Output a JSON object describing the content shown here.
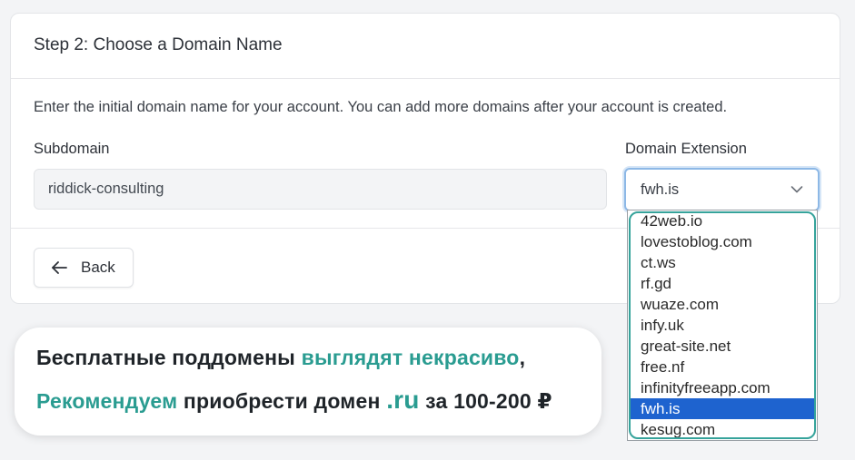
{
  "colors": {
    "accent_teal": "#2a9c91",
    "selected_option": "#1e63cf",
    "focus_ring": "#8db8e6",
    "page_background": "#f3f4f6"
  },
  "step": {
    "title": "Step 2: Choose a Domain Name",
    "description": "Enter the initial domain name for your account. You can add more domains after your account is created."
  },
  "subdomain": {
    "label": "Subdomain",
    "value": "riddick-consulting"
  },
  "domain_extension": {
    "label": "Domain Extension",
    "selected": "fwh.is",
    "icon": "chevron-down-icon",
    "options": [
      "42web.io",
      "lovestoblog.com",
      "ct.ws",
      "rf.gd",
      "wuaze.com",
      "infy.uk",
      "great-site.net",
      "free.nf",
      "infinityfreeapp.com",
      "fwh.is",
      "kesug.com"
    ],
    "selected_index": 9
  },
  "footer": {
    "back_label": "Back",
    "back_icon": "arrow-left-icon"
  },
  "promo": {
    "line1_a": "Бесплатные поддомены ",
    "line1_b": "выглядят некрасиво",
    "line1_c": ",",
    "line2_a": "Рекомендуем",
    "line2_b": " приобрести домен ",
    "line2_c": ".ru",
    "line2_d": " за 100-200 ₽"
  }
}
